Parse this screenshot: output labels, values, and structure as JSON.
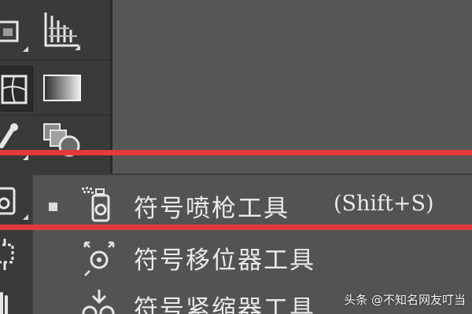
{
  "colors": {
    "panel_bg": "#3a3a3a",
    "canvas_bg": "#565656",
    "menu_bg": "#535353",
    "highlight_red": "#e23a3a",
    "text": "#eaeaea"
  },
  "toolbar": {
    "tools": [
      {
        "icon": "frame-icon"
      },
      {
        "icon": "perspective-grid-icon"
      },
      {
        "icon": "mesh-tool-icon"
      },
      {
        "icon": "gradient-tool-icon"
      },
      {
        "icon": "eyedropper-icon"
      },
      {
        "icon": "blend-tool-icon"
      },
      {
        "icon": "symbol-sprayer-icon"
      },
      {
        "icon": "artboard-icon"
      },
      {
        "icon": "hand-icon"
      }
    ]
  },
  "flyout": {
    "items": [
      {
        "label": "符号喷枪工具",
        "shortcut": "(Shift+S)",
        "icon": "symbol-sprayer-icon",
        "selected": true
      },
      {
        "label": "符号移位器工具",
        "shortcut": "",
        "icon": "symbol-shifter-icon",
        "selected": false
      },
      {
        "label": "符号紧缩器工具",
        "shortcut": "",
        "icon": "symbol-scruncher-icon",
        "selected": false
      }
    ]
  },
  "watermark": {
    "text": "头条 @不知名网友叮当"
  }
}
